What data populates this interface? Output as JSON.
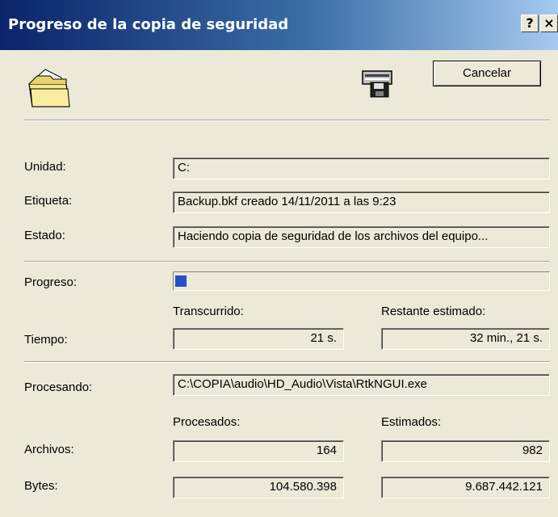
{
  "window": {
    "title": "Progreso de la copia de seguridad",
    "help_label": "?",
    "close_label": "×"
  },
  "cancel_label": "Cancelar",
  "icons": {
    "left": "folder-icon",
    "right": "backup-drive-icon"
  },
  "rows": {
    "unidad": {
      "label": "Unidad:",
      "value": "C:"
    },
    "etiqueta": {
      "label": "Etiqueta:",
      "value": "Backup.bkf creado 14/11/2011 a las 9:23"
    },
    "estado": {
      "label": "Estado:",
      "value": "Haciendo copia de seguridad de los archivos del equipo..."
    }
  },
  "progress": {
    "label": "Progreso:",
    "fraction": 0.03,
    "color": "#2650c8"
  },
  "time": {
    "label": "Tiempo:",
    "elapsed_header": "Transcurrido:",
    "remaining_header": "Restante estimado:",
    "elapsed": "21 s.",
    "remaining": "32 min., 21 s."
  },
  "processing": {
    "label": "Procesando:",
    "value": "C:\\COPIA\\audio\\HD_Audio\\Vista\\RtkNGUI.exe"
  },
  "counts": {
    "processed_header": "Procesados:",
    "estimated_header": "Estimados:",
    "files_label": "Archivos:",
    "files_processed": "164",
    "files_estimated": "982",
    "bytes_label": "Bytes:",
    "bytes_processed": "104.580.398",
    "bytes_estimated": "9.687.442.121"
  }
}
